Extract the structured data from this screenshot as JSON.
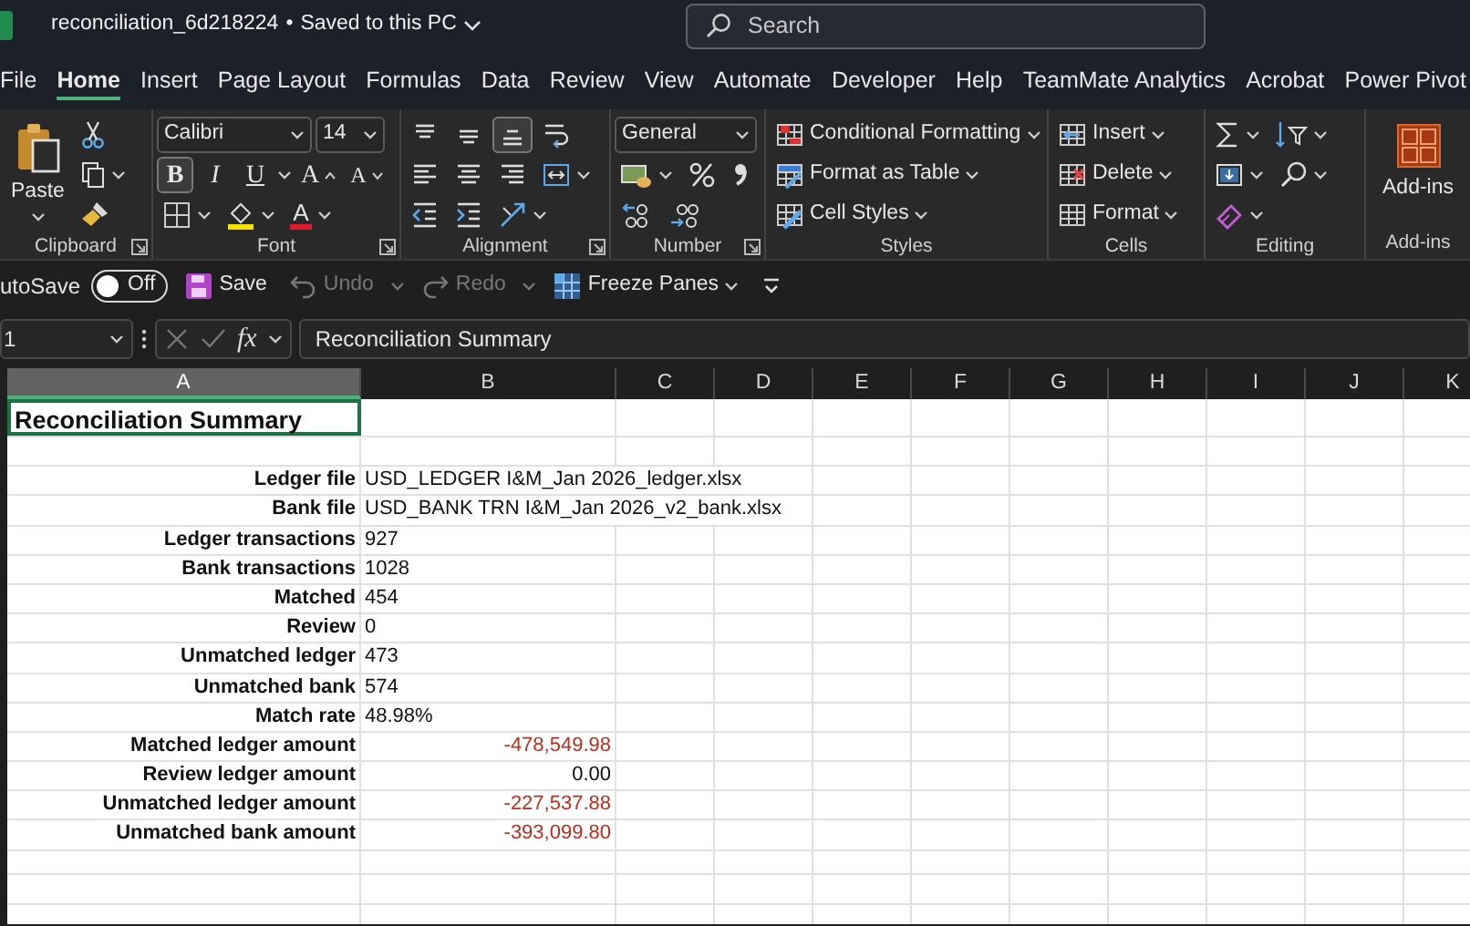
{
  "title_bar": {
    "file_name": "reconciliation_6d218224",
    "separator": "•",
    "save_status": "Saved to this PC",
    "search_placeholder": "Search"
  },
  "menu_tabs": [
    {
      "label": "File",
      "selected": false
    },
    {
      "label": "Home",
      "selected": true
    },
    {
      "label": "Insert",
      "selected": false
    },
    {
      "label": "Page Layout",
      "selected": false
    },
    {
      "label": "Formulas",
      "selected": false
    },
    {
      "label": "Data",
      "selected": false
    },
    {
      "label": "Review",
      "selected": false
    },
    {
      "label": "View",
      "selected": false
    },
    {
      "label": "Automate",
      "selected": false
    },
    {
      "label": "Developer",
      "selected": false
    },
    {
      "label": "Help",
      "selected": false
    },
    {
      "label": "TeamMate Analytics",
      "selected": false
    },
    {
      "label": "Acrobat",
      "selected": false
    },
    {
      "label": "Power Pivot",
      "selected": false
    }
  ],
  "ribbon": {
    "clipboard": {
      "paste": "Paste",
      "label": "Clipboard"
    },
    "font": {
      "name": "Calibri",
      "size": "14",
      "styles": [
        {
          "label": "B",
          "selected": true
        },
        {
          "label": "I",
          "selected": false
        },
        {
          "label": "U",
          "selected": false
        }
      ],
      "grow": "A",
      "shrink": "A",
      "font_color": "A",
      "label": "Font"
    },
    "alignment": {
      "vertical": [
        {
          "selected": false
        },
        {
          "selected": false
        },
        {
          "selected": true
        }
      ],
      "label": "Alignment"
    },
    "number": {
      "format": "General",
      "label": "Number"
    },
    "styles": {
      "buttons": [
        "Conditional Formatting",
        "Format as Table",
        "Cell Styles"
      ],
      "label": "Styles"
    },
    "cells": {
      "buttons": [
        "Insert",
        "Delete",
        "Format"
      ],
      "label": "Cells"
    },
    "editing": {
      "label": "Editing"
    },
    "add_ins": {
      "button": "Add-ins",
      "label": "Add-ins"
    }
  },
  "quick_access": {
    "autosave_label": "utoSave",
    "autosave": {
      "on": false,
      "label": "Off"
    },
    "save": "Save",
    "undo": {
      "label": "Undo",
      "disabled": true
    },
    "redo": {
      "label": "Redo",
      "disabled": true
    },
    "freeze_panes": "Freeze Panes"
  },
  "formula_bar": {
    "name_box": "1",
    "function_label": "fx",
    "formula": "Reconciliation Summary"
  },
  "sheet": {
    "columns": [
      {
        "label": "A",
        "selected": true
      },
      {
        "label": "B",
        "selected": false
      },
      {
        "label": "C",
        "selected": false
      },
      {
        "label": "D",
        "selected": false
      },
      {
        "label": "E",
        "selected": false
      },
      {
        "label": "F",
        "selected": false
      },
      {
        "label": "G",
        "selected": false
      },
      {
        "label": "H",
        "selected": false
      },
      {
        "label": "I",
        "selected": false
      },
      {
        "label": "J",
        "selected": false
      },
      {
        "label": "K",
        "selected": false
      }
    ],
    "title": {
      "text": "Reconciliation Summary",
      "selected": true
    },
    "rows": [
      {
        "label": "Ledger file",
        "value": "USD_LEDGER I&M_Jan 2026_ledger.xlsx",
        "kind": "text",
        "negative": false
      },
      {
        "label": "Bank file",
        "value": "USD_BANK TRN I&M_Jan 2026_v2_bank.xlsx",
        "kind": "text",
        "negative": false
      },
      {
        "label": "Ledger transactions",
        "value": "927",
        "kind": "text",
        "negative": false
      },
      {
        "label": "Bank transactions",
        "value": "1028",
        "kind": "text",
        "negative": false
      },
      {
        "label": "Matched",
        "value": "454",
        "kind": "text",
        "negative": false
      },
      {
        "label": "Review",
        "value": "0",
        "kind": "text",
        "negative": false
      },
      {
        "label": "Unmatched ledger",
        "value": "473",
        "kind": "text",
        "negative": false
      },
      {
        "label": "Unmatched bank",
        "value": "574",
        "kind": "text",
        "negative": false
      },
      {
        "label": "Match rate",
        "value": "48.98%",
        "kind": "text",
        "negative": false
      },
      {
        "label": "Matched ledger amount",
        "value": "-478,549.98",
        "kind": "amount",
        "negative": true
      },
      {
        "label": "Review ledger amount",
        "value": "0.00",
        "kind": "amount",
        "negative": false
      },
      {
        "label": "Unmatched ledger amount",
        "value": "-227,537.88",
        "kind": "amount",
        "negative": true
      },
      {
        "label": "Unmatched bank amount",
        "value": "-393,099.80",
        "kind": "amount",
        "negative": true
      }
    ]
  }
}
